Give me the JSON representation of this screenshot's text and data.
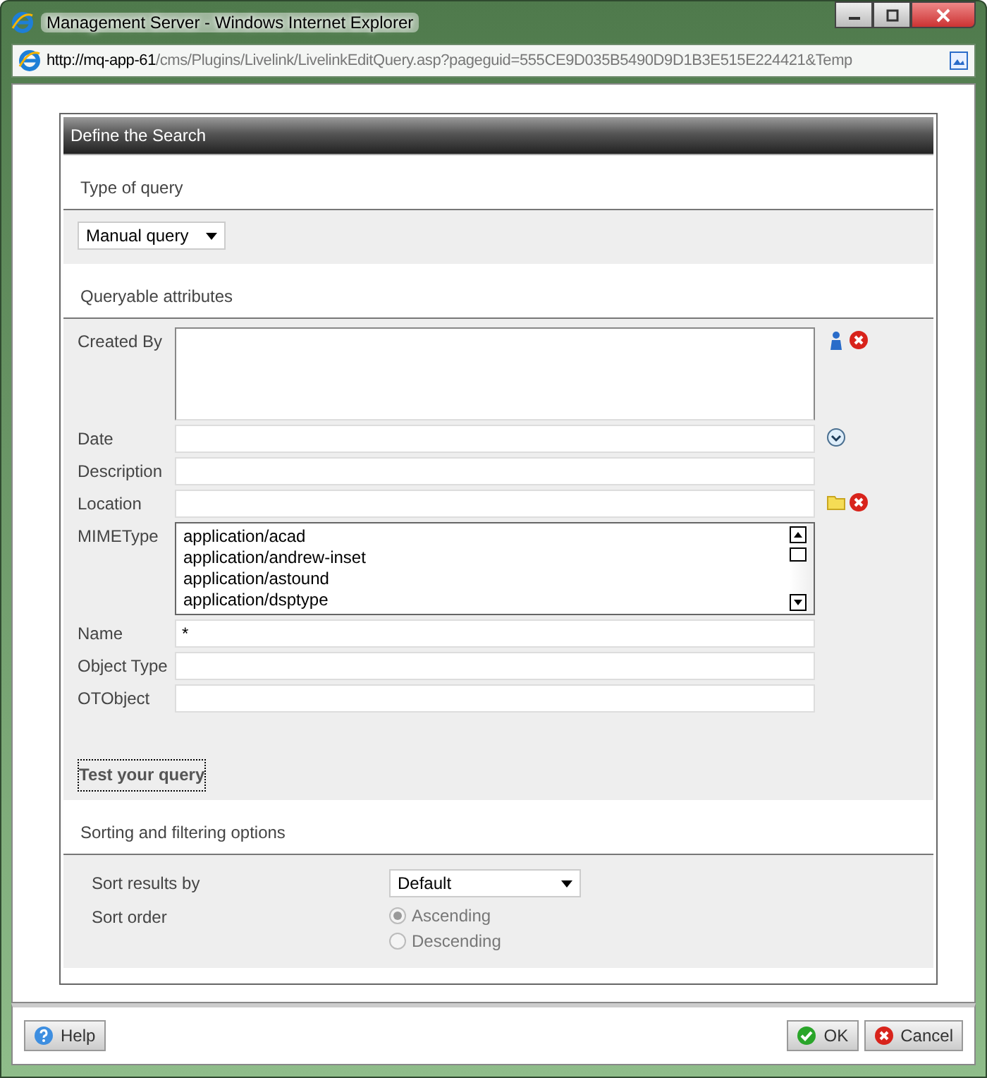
{
  "window": {
    "title": "Management Server - Windows Internet Explorer"
  },
  "address": {
    "url_host": "http://mq-app-61",
    "url_path": "/cms/Plugins/Livelink/LivelinkEditQuery.asp?pageguid=555CE9D035B5490D9D1B3E515E224421&Temp"
  },
  "panel": {
    "title": "Define the Search"
  },
  "query_type": {
    "heading": "Type of query",
    "value": "Manual query"
  },
  "attributes": {
    "heading": "Queryable attributes",
    "items": [
      {
        "label": "Created By",
        "kind": "people",
        "value": ""
      },
      {
        "label": "Date",
        "kind": "date",
        "value": ""
      },
      {
        "label": "Description",
        "kind": "text",
        "value": ""
      },
      {
        "label": "Location",
        "kind": "location",
        "value": ""
      },
      {
        "label": "MIMEType",
        "kind": "list",
        "options": [
          "application/acad",
          "application/andrew-inset",
          "application/astound",
          "application/dsptype"
        ]
      },
      {
        "label": "Name",
        "kind": "text",
        "value": "*"
      },
      {
        "label": "Object Type",
        "kind": "text",
        "value": ""
      },
      {
        "label": "OTObject",
        "kind": "text",
        "value": ""
      }
    ]
  },
  "test_button": "Test your query",
  "sorting": {
    "heading": "Sorting and filtering options",
    "sort_by_label": "Sort results by",
    "sort_by_value": "Default",
    "order_label": "Sort order",
    "orders": [
      {
        "label": "Ascending",
        "selected": true,
        "disabled": true
      },
      {
        "label": "Descending",
        "selected": false,
        "disabled": true
      }
    ]
  },
  "buttons": {
    "help": "Help",
    "ok": "OK",
    "cancel": "Cancel"
  }
}
